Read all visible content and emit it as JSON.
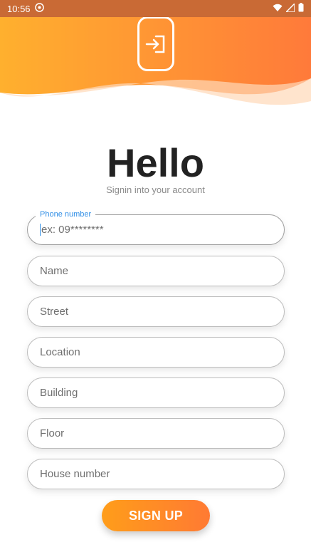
{
  "status_bar": {
    "time": "10:56",
    "left_icon": "android-debug-icon",
    "right_icons": [
      "wifi-icon",
      "signal-icon",
      "battery-icon"
    ]
  },
  "header": {
    "icon": "login-icon",
    "gradient": [
      "#ffb02e",
      "#ff7a3a"
    ]
  },
  "page": {
    "title": "Hello",
    "subtitle": "Signin into your account"
  },
  "form": {
    "phone": {
      "label": "Phone number",
      "placeholder": "ex: 09********"
    },
    "fields": [
      "Name",
      "Street",
      "Location",
      "Building",
      "Floor",
      "House number"
    ]
  },
  "actions": {
    "signup": "SIGN UP"
  },
  "colors": {
    "accent": "#ff8a2a",
    "label_blue": "#2f8ee6",
    "status_bar": "#c96a35"
  }
}
